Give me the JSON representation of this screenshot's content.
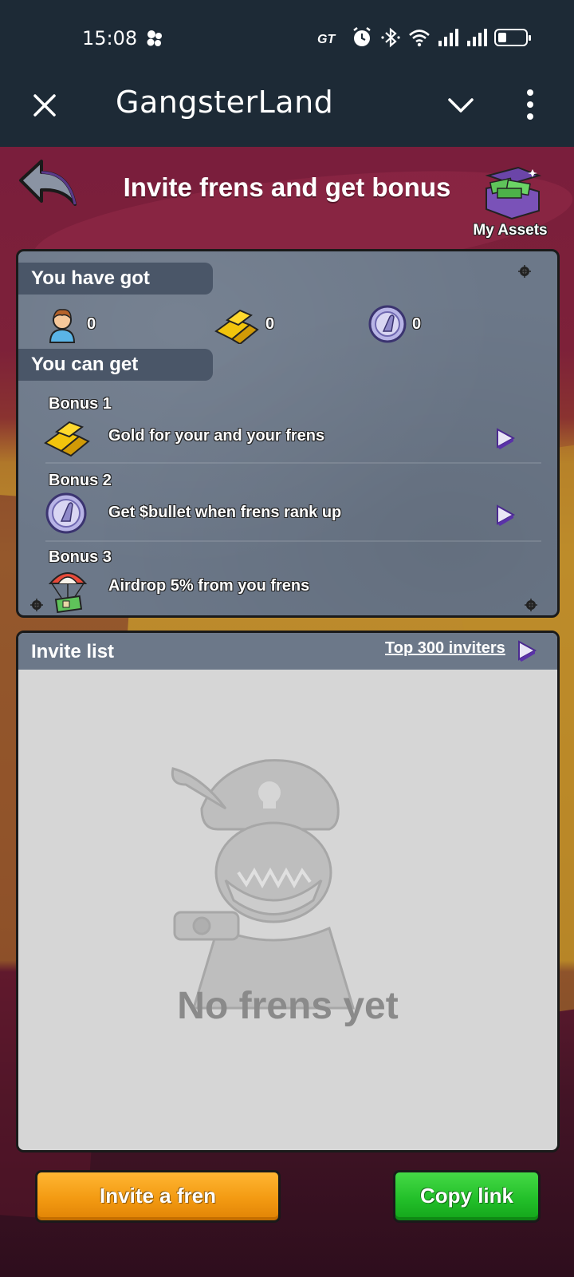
{
  "status_bar": {
    "time": "15:08",
    "battery_level": 0.3
  },
  "app_bar": {
    "title": "GangsterLand"
  },
  "header": {
    "title": "Invite frens and get bonus",
    "assets_label": "My Assets"
  },
  "got_section": {
    "label": "You have got",
    "items": [
      {
        "icon": "fren-icon",
        "value": "0"
      },
      {
        "icon": "gold-bar-icon",
        "value": "0"
      },
      {
        "icon": "bullet-coin-icon",
        "value": "0"
      }
    ]
  },
  "can_get_section": {
    "label": "You can get",
    "bonuses": [
      {
        "title": "Bonus 1",
        "text": "Gold for your and your frens",
        "icon": "gold-bar-icon"
      },
      {
        "title": "Bonus 2",
        "text": "Get $bullet when frens rank up",
        "icon": "bullet-coin-icon"
      },
      {
        "title": "Bonus 3",
        "text": "Airdrop 5% from you frens",
        "icon": "airdrop-icon"
      }
    ]
  },
  "invite_list": {
    "title": "Invite list",
    "top_link": "Top 300 inviters",
    "empty_text": "No frens yet"
  },
  "buttons": {
    "invite": "Invite a fren",
    "copy": "Copy link"
  },
  "colors": {
    "panel": "#6c7889",
    "orange_button": "#f39a12",
    "green_button": "#23c02a"
  }
}
